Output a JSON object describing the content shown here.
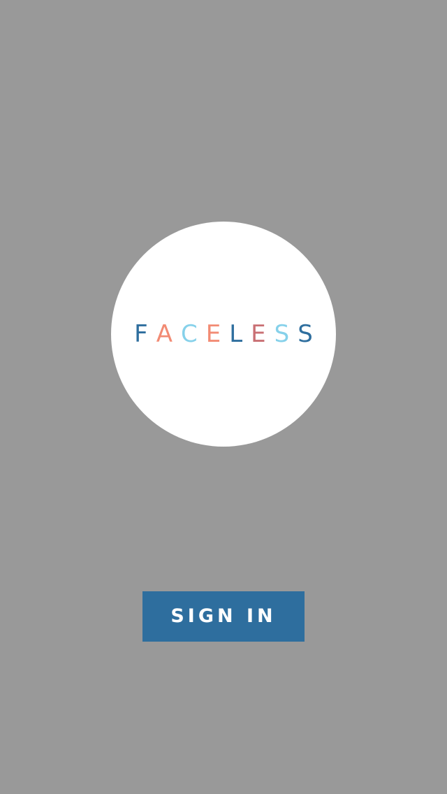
{
  "logo": {
    "letters": [
      {
        "char": "F",
        "color": "#2e6e9e"
      },
      {
        "char": "A",
        "color": "#f28b74"
      },
      {
        "char": "C",
        "color": "#86d1ea"
      },
      {
        "char": "E",
        "color": "#f28b74"
      },
      {
        "char": "L",
        "color": "#2e6e9e"
      },
      {
        "char": "E",
        "color": "#c96f73"
      },
      {
        "char": "S",
        "color": "#86d1ea"
      },
      {
        "char": "S",
        "color": "#2e6e9e"
      }
    ]
  },
  "actions": {
    "signin_label": "SIGN IN"
  },
  "colors": {
    "background": "#999999",
    "circle": "#ffffff",
    "button": "#2e6e9e",
    "button_text": "#ffffff"
  }
}
